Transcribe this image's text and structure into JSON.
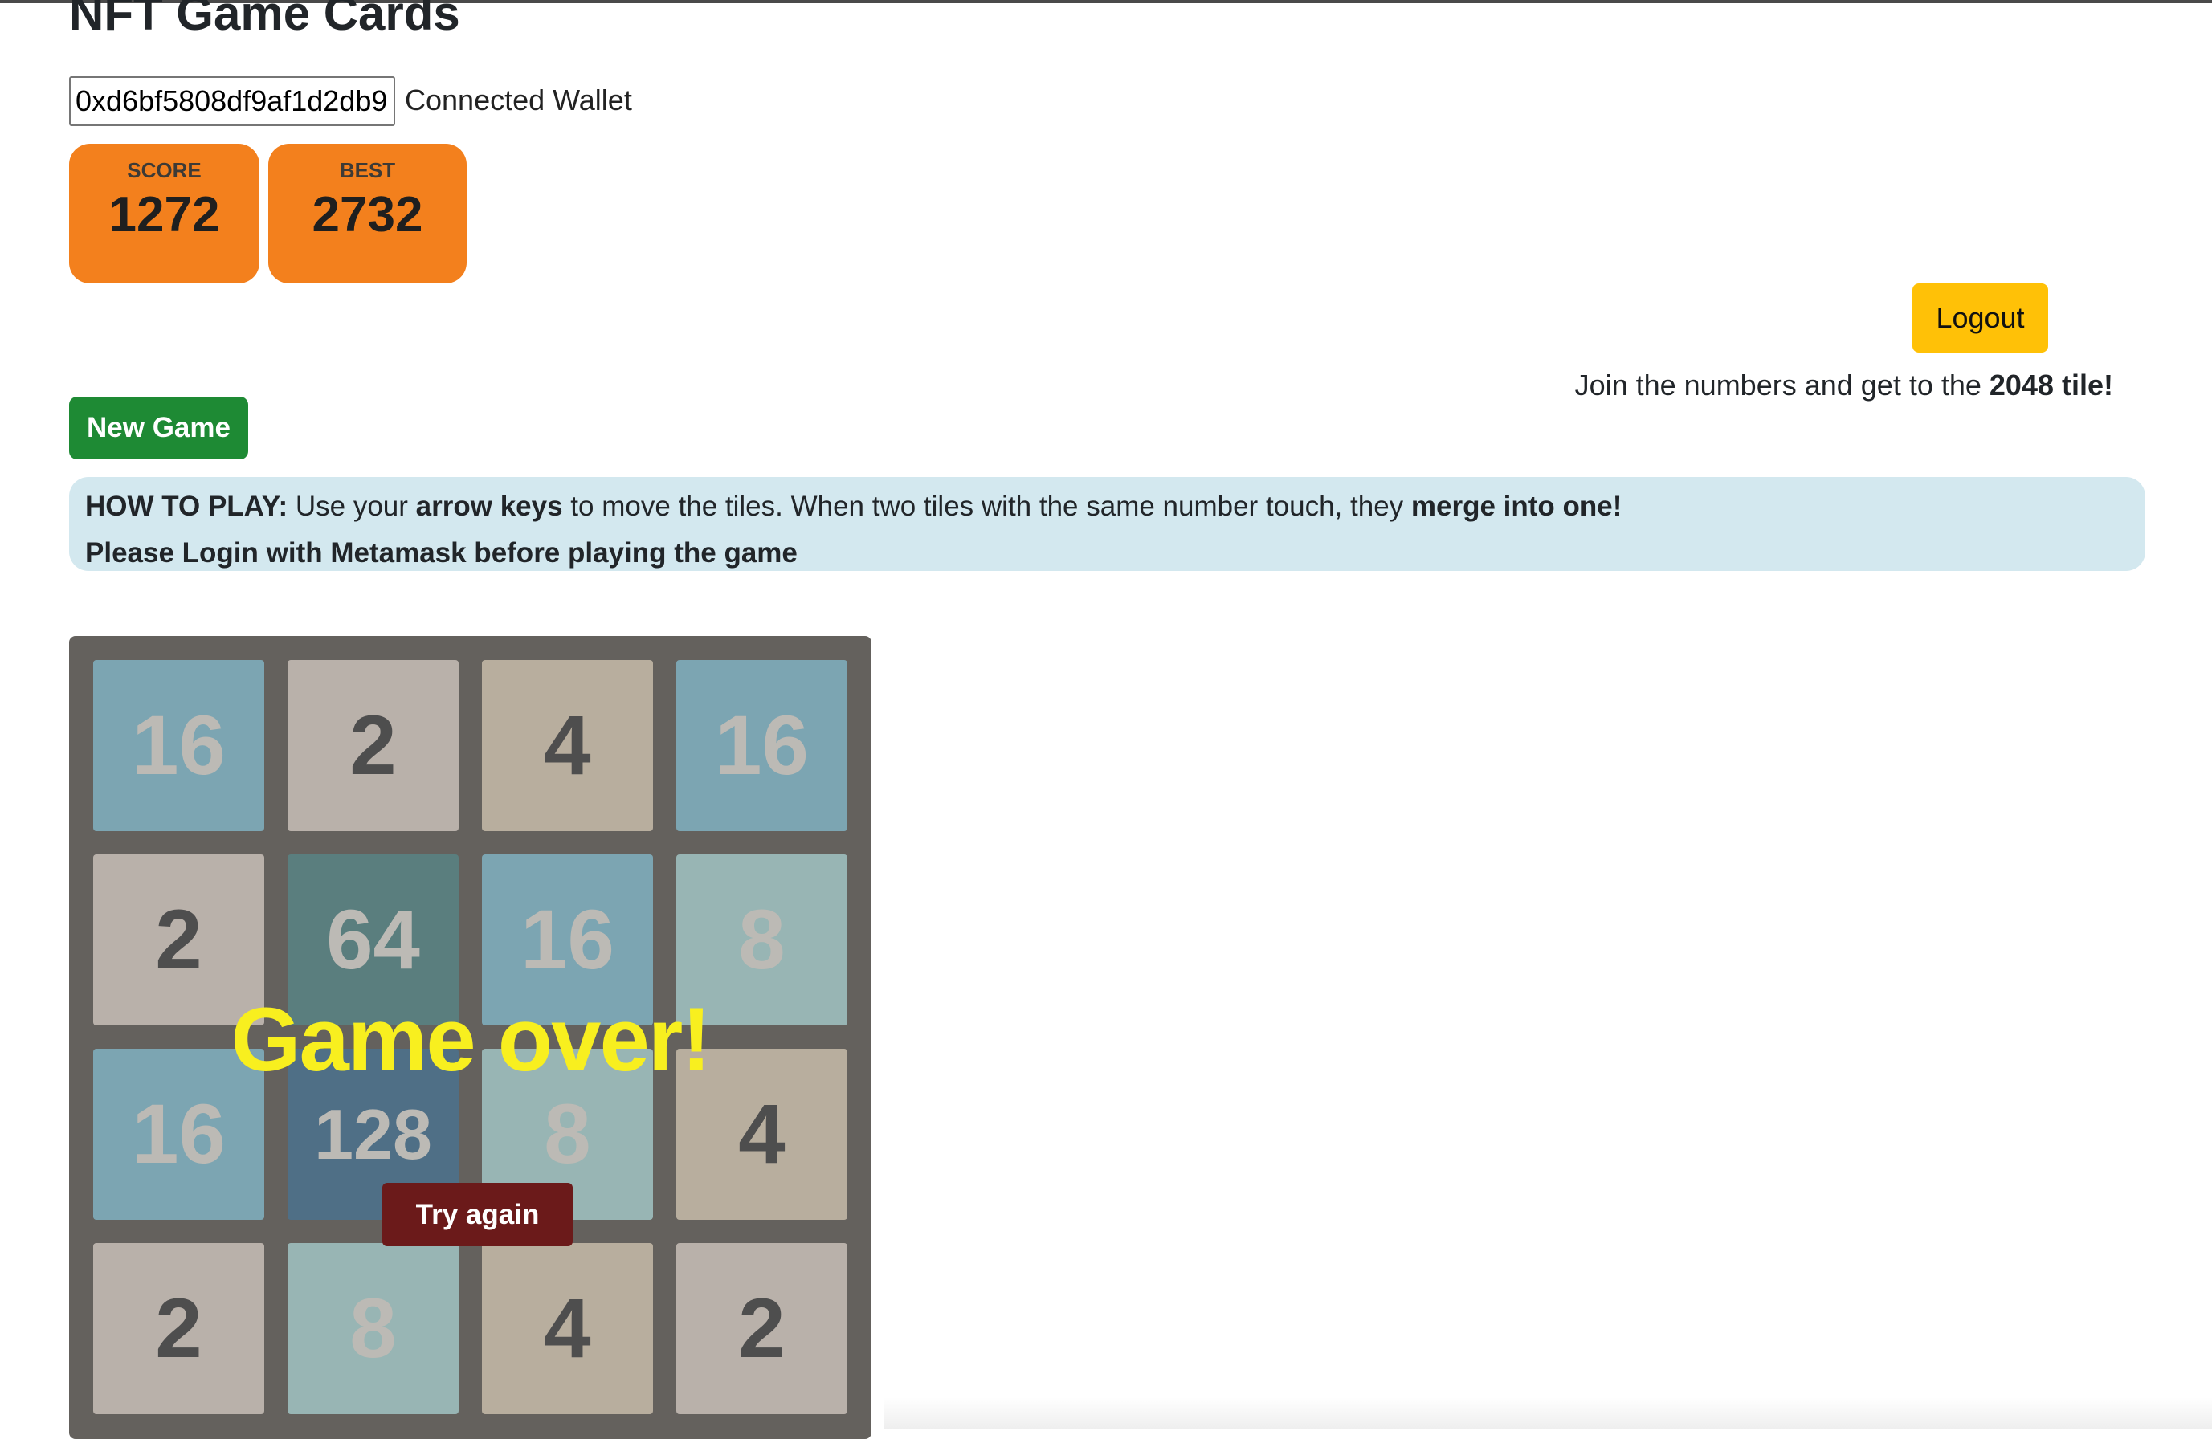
{
  "header": {
    "title": "NFT Game Cards"
  },
  "wallet": {
    "address": "0xd6bf5808df9af1d2db9",
    "label": "Connected Wallet"
  },
  "scores": {
    "score_label": "SCORE",
    "score": "1272",
    "best_label": "BEST",
    "best": "2732"
  },
  "actions": {
    "logout": "Logout",
    "new_game": "New Game",
    "try_again": "Try again"
  },
  "intro": {
    "prefix": "Join the numbers and get to the ",
    "bold": "2048 tile!"
  },
  "howto": {
    "heading": "HOW TO PLAY:",
    "t1": " Use your ",
    "b1": "arrow keys",
    "t2": " to move the tiles. When two tiles with the same number touch, they ",
    "b2": "merge into one!",
    "login_note": "Please Login with Metamask before playing the game"
  },
  "game": {
    "status": "Game over!",
    "grid": [
      [
        16,
        2,
        4,
        16
      ],
      [
        2,
        64,
        16,
        8
      ],
      [
        16,
        128,
        8,
        4
      ],
      [
        2,
        8,
        4,
        2
      ]
    ],
    "tile_colors": {
      "2": "#b9b1aa",
      "4": "#b8ae9e",
      "8": "#98b5b4",
      "16": "#7ca5b2",
      "64": "#5a7e7e",
      "128": "#4f6f86"
    },
    "colors": {
      "board": "#64615d",
      "score_box": "#f3801d",
      "logout": "#ffc107",
      "new_game": "#1e8a34",
      "game_over": "#f8ef1f",
      "try_again": "#6b1a1a"
    }
  }
}
